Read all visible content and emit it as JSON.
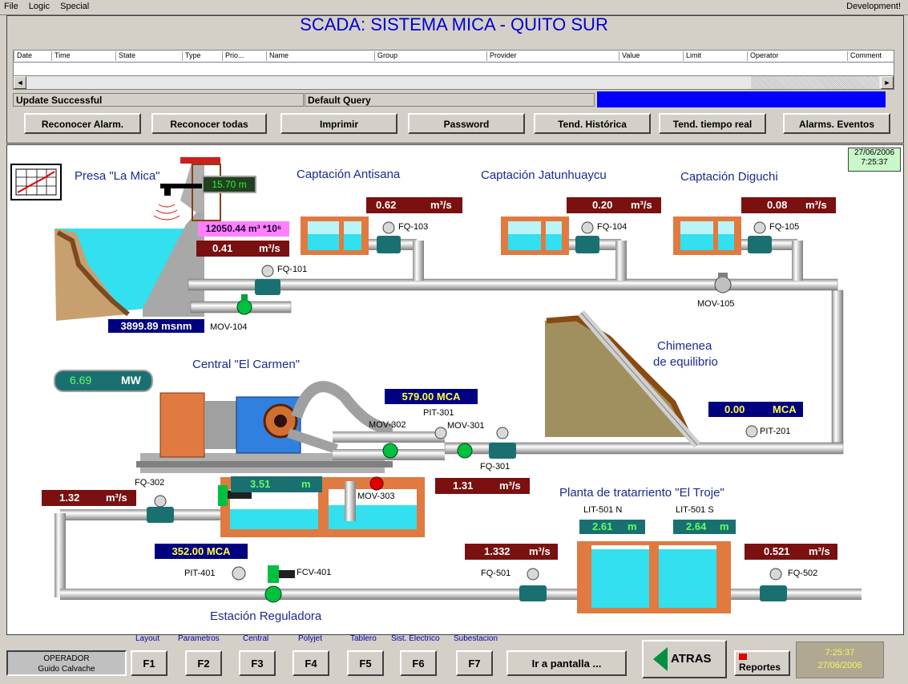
{
  "menu": {
    "file": "File",
    "logic": "Logic",
    "special": "Special",
    "dev": "Development!"
  },
  "title": "SCADA: SISTEMA MICA - QUITO SUR",
  "columns": [
    "Date",
    "Time",
    "State",
    "Type",
    "Prio...",
    "Name",
    "Group",
    "Provider",
    "Value",
    "Limit",
    "Operator",
    "Comment"
  ],
  "status": {
    "left": "Update Successful",
    "query": "Default Query"
  },
  "buttons": [
    "Reconocer Alarm.",
    "Reconocer todas",
    "Imprimir",
    "Password",
    "Tend. Histórica",
    "Tend. tiempo real",
    "Alarms. Eventos"
  ],
  "datetime_box": {
    "date": "27/06/2006",
    "time": "7:25:37"
  },
  "labels": {
    "presa": "Presa \"La Mica\"",
    "antisana": "Captación Antisana",
    "jatunhuaycu": "Captación Jatunhuaycu",
    "diguchi": "Captación Diguchi",
    "chimenea1": "Chimenea",
    "chimenea2": "de equilibrio",
    "central": "Central \"El Carmen\"",
    "planta": "Planta de tratarriento \"El Troje\"",
    "estacion": "Estación Reguladora"
  },
  "values": {
    "level_presa": "15.70  m",
    "volume": "12050.44  m³ *10⁶",
    "flow_presa": "0.41",
    "altitude": "3899.89 msnm",
    "flow_fq103": "0.62",
    "flow_fq104": "0.20",
    "flow_fq105": "0.08",
    "power": "6.69",
    "power_unit": "MW",
    "pit301": "579.00  MCA",
    "pit201": "0.00",
    "pit201_unit": "MCA",
    "flow_fq301": "1.31",
    "flow_fq302": "1.32",
    "level_tank": "3.51",
    "level_tank_unit": "m",
    "pit401": "352.00  MCA",
    "flow_fq501": "1.332",
    "flow_fq502": "0.521",
    "lit501n": "2.61",
    "lit501s": "2.64",
    "unit_m": "m",
    "flow_unit": "m³/s"
  },
  "tags": {
    "fq101": "FQ-101",
    "fq103": "FQ-103",
    "fq104": "FQ-104",
    "fq105": "FQ-105",
    "mov104": "MOV-104",
    "mov105": "MOV-105",
    "pit301": "PIT-301",
    "mov302": "MOV-302",
    "mov301": "MOV-301",
    "fq301": "FQ-301",
    "pit201": "PIT-201",
    "fq302": "FQ-302",
    "mov303": "MOV-303",
    "pit401": "PIT-401",
    "fcv401": "FCV-401",
    "fq501": "FQ-501",
    "fq502": "FQ-502",
    "lit501n": "LIT-501 N",
    "lit501s": "LIT-501 S"
  },
  "bottom": {
    "operator_role": "OPERADOR",
    "operator_name": "Guido Calvache",
    "fkeys": [
      {
        "label": "Layout",
        "key": "F1"
      },
      {
        "label": "Parametros",
        "key": "F2"
      },
      {
        "label": "Central",
        "key": "F3"
      },
      {
        "label": "Polyjet",
        "key": "F4"
      },
      {
        "label": "Tablero",
        "key": "F5"
      },
      {
        "label": "Sist. Electrico",
        "key": "F6"
      },
      {
        "label": "Subestacion",
        "key": "F7"
      }
    ],
    "goto": "Ir a pantalla ...",
    "back": "ATRAS",
    "reports": "Reportes",
    "clock_time": "7:25:37",
    "clock_date": "27/06/2006"
  },
  "colors": {
    "accent_blue": "#0000ff",
    "value_red": "#7a1010",
    "pipe": "#c0c0c0",
    "water": "#33e0f0",
    "brick": "#e07a40",
    "valve_green": "#00c040"
  }
}
